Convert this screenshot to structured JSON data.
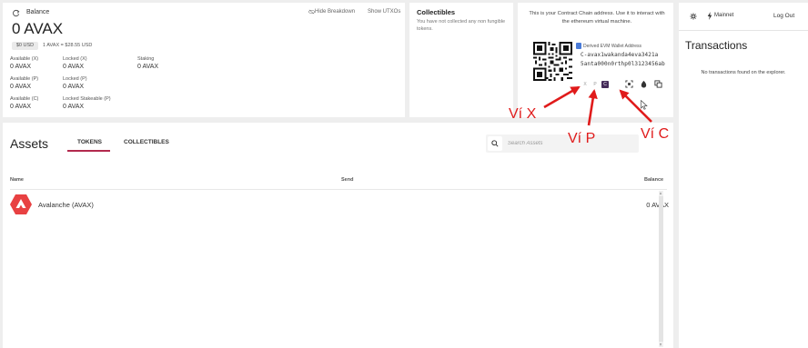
{
  "balance": {
    "label": "Balance",
    "hide_breakdown": "Hide Breakdown",
    "show_utxos": "Show UTXOs",
    "total": "0 AVAX",
    "usd": "$0 USD",
    "rate": "1 AVAX = $28.55 USD",
    "breakdown": {
      "available_x_label": "Available (X)",
      "available_x_value": "0 AVAX",
      "available_p_label": "Available (P)",
      "available_p_value": "0 AVAX",
      "available_c_label": "Available (C)",
      "available_c_value": "0 AVAX",
      "locked_x_label": "Locked (X)",
      "locked_x_value": "0 AVAX",
      "locked_p_label": "Locked (P)",
      "locked_p_value": "0 AVAX",
      "locked_stakeable_label": "Locked Stakeable (P)",
      "locked_stakeable_value": "0 AVAX",
      "staking_label": "Staking",
      "staking_value": "0 AVAX"
    }
  },
  "collectibles": {
    "title": "Collectibles",
    "empty_text": "You have not collected any non fungible tokens."
  },
  "address": {
    "note": "This is your Contract Chain address. Use it to interact with the ethereum virtual machine.",
    "evm_label": "Derived EVM Wallet Address",
    "line1": "C-avax1wakanda4eva3421a",
    "line2": "5anta000n0rthp0l3123456ab",
    "chains": [
      "X",
      "P",
      "C"
    ],
    "active_chain": "C"
  },
  "sidebar": {
    "network": "Mainnet",
    "logout": "Log Out",
    "transactions_title": "Transactions",
    "empty": "No transactions found on the explorer."
  },
  "assets": {
    "title": "Assets",
    "tab_tokens": "TOKENS",
    "tab_collectibles": "COLLECTIBLES",
    "search_placeholder": "Search Assets",
    "columns": {
      "name": "Name",
      "send": "Send",
      "balance": "Balance"
    },
    "rows": [
      {
        "name": "Avalanche (AVAX)",
        "balance": "0  AVAX"
      }
    ]
  },
  "annotations": {
    "x_wallet": "Ví X",
    "p_wallet": "Ví P",
    "c_wallet": "Ví C"
  },
  "colors": {
    "accent": "#b22a4e",
    "chain_active": "#442b59",
    "annotation": "#e01b1b",
    "avax_red": "#e84142"
  }
}
